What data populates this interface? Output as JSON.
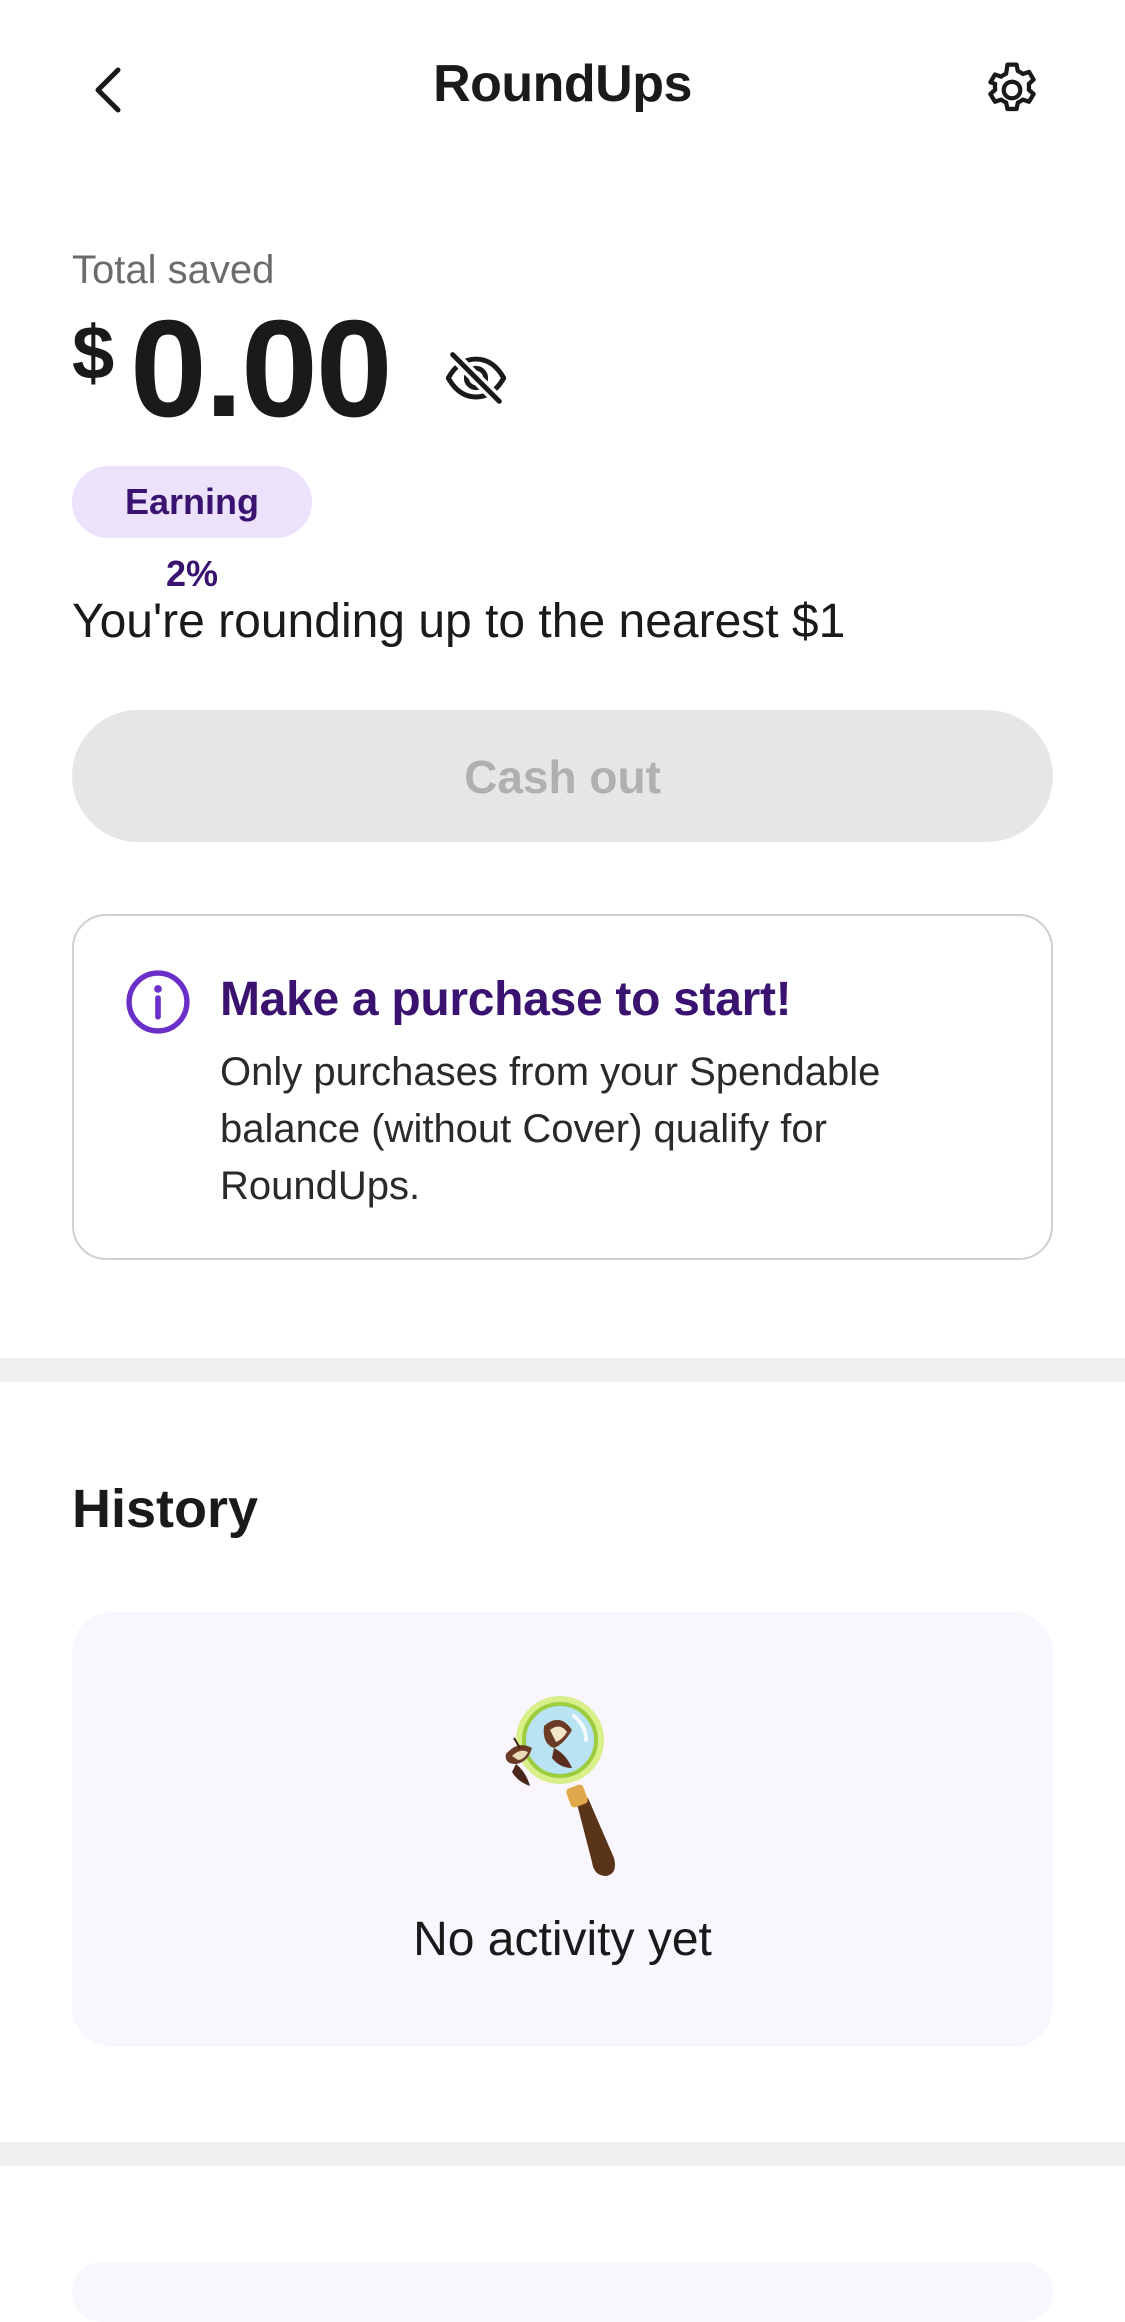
{
  "header": {
    "title": "RoundUps",
    "back_icon": "chevron-left-icon",
    "settings_icon": "gear-icon"
  },
  "savings": {
    "label": "Total saved",
    "currency": "$",
    "amount": "0.00",
    "visibility_icon": "eye-off-icon",
    "badge": "Earning 2%",
    "rounding_text": "You're rounding up to the nearest $1"
  },
  "actions": {
    "cash_out_label": "Cash out",
    "cash_out_enabled": false
  },
  "info_card": {
    "icon": "info-icon",
    "title": "Make a purchase to start!",
    "body": "Only purchases from your Spendable balance (without Cover) qualify for RoundUps."
  },
  "history": {
    "title": "History",
    "illustration": "magnifying-glass-butterfly",
    "empty_text": "No activity yet"
  },
  "colors": {
    "accent_purple": "#6b2fc9",
    "title_purple": "#3a1270",
    "badge_bg": "#ede2fb",
    "disabled_button_bg": "#e6e6e8",
    "disabled_button_text": "#b0b0b3",
    "history_card_bg": "#f9f6fd"
  }
}
